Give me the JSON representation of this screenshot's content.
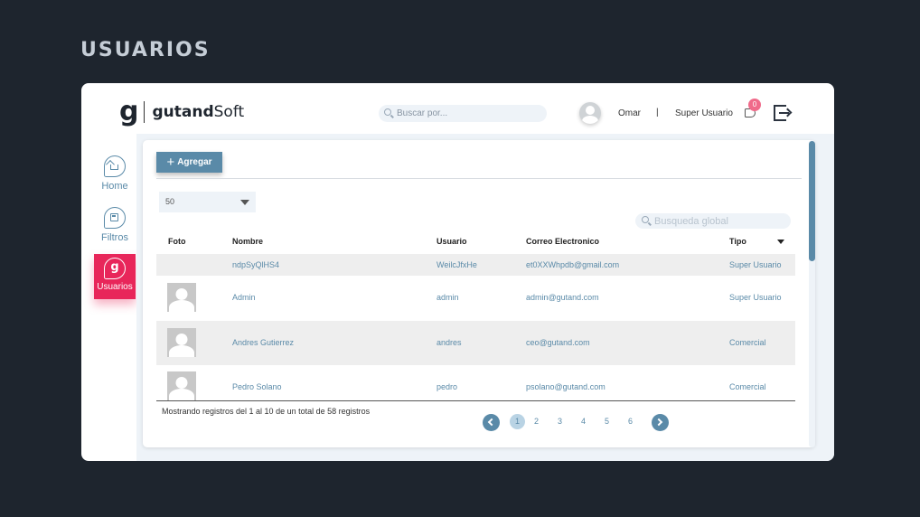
{
  "page_heading": "USUARIOS",
  "brand": {
    "letter": "g",
    "name_bold": "gutand",
    "name_rest": "Soft"
  },
  "header": {
    "search_placeholder": "Buscar por...",
    "user_name": "Omar",
    "separator": "|",
    "user_role": "Super Usuario",
    "notification_count": "0"
  },
  "sidebar": {
    "items": [
      {
        "label": "Home",
        "icon": "home-icon",
        "active": false
      },
      {
        "label": "Filtros",
        "icon": "calculator-icon",
        "active": false
      },
      {
        "label": "Usuarios",
        "icon": "gutand-g-icon",
        "active": true,
        "icon_letter": "g"
      }
    ]
  },
  "toolbar": {
    "add_label": "Agregar",
    "add_icon": "+"
  },
  "pagesize": {
    "selected": "50"
  },
  "global_search": {
    "placeholder": "Busqueda global"
  },
  "table": {
    "columns": [
      "Foto",
      "Nombre",
      "Usuario",
      "Correo Electronico",
      "Tipo"
    ],
    "rows": [
      {
        "has_photo": false,
        "nombre": "ndpSyQlHS4",
        "usuario": "WeilcJfxHe",
        "correo": "et0XXWhpdb@gmail.com",
        "tipo": "Super Usuario"
      },
      {
        "has_photo": true,
        "nombre": "Admin",
        "usuario": "admin",
        "correo": "admin@gutand.com",
        "tipo": "Super Usuario"
      },
      {
        "has_photo": true,
        "nombre": "Andres Gutierrez",
        "usuario": "andres",
        "correo": "ceo@gutand.com",
        "tipo": "Comercial"
      },
      {
        "has_photo": true,
        "nombre": "Pedro Solano",
        "usuario": "pedro",
        "correo": "psolano@gutand.com",
        "tipo": "Comercial"
      }
    ]
  },
  "pagination": {
    "info": "Mostrando registros del 1 al 10 de un total de 58 registros",
    "pages": [
      "1",
      "2",
      "3",
      "4",
      "5",
      "6"
    ],
    "current": "1"
  },
  "colors": {
    "background": "#1e252e",
    "accent": "#5a8aa8",
    "active_nav": "#e8265a",
    "badge": "#f06a8a",
    "content_bg": "#eef3f8"
  }
}
